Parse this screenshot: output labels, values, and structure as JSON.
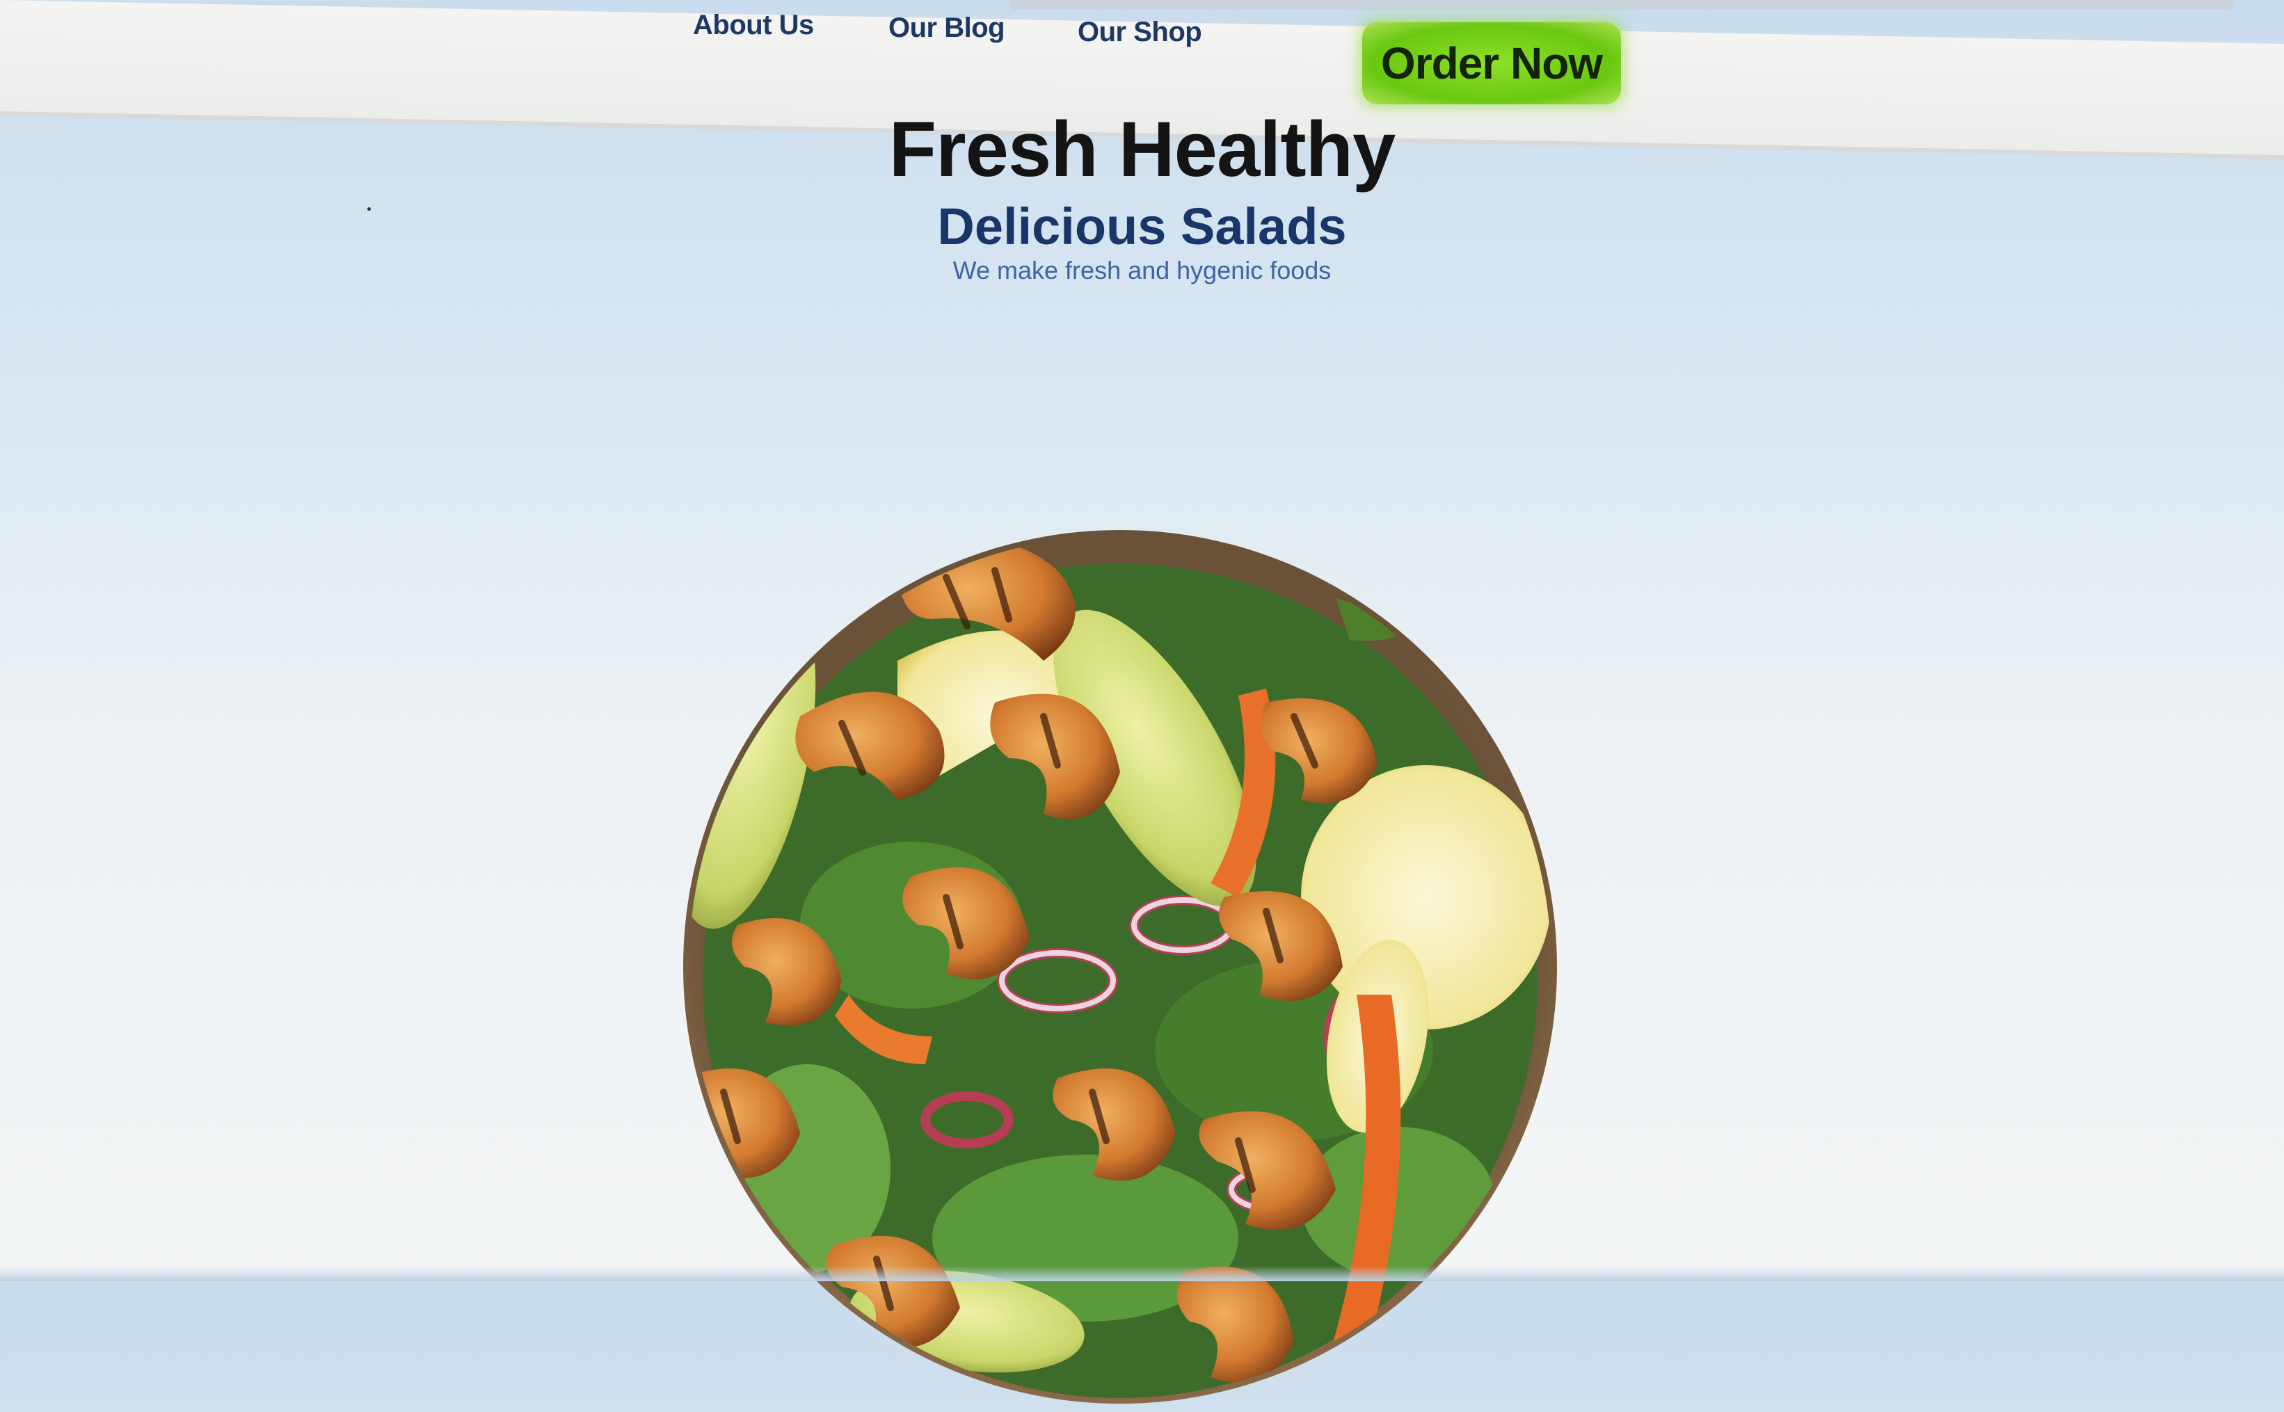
{
  "nav": {
    "links": [
      {
        "label": "About Us"
      },
      {
        "label": "Our Blog"
      },
      {
        "label": "Our Shop"
      }
    ],
    "cta_label": "Order Now"
  },
  "hero": {
    "title": "Fresh Healthy",
    "subtitle": "Delicious Salads",
    "tagline": "We make fresh and hygenic foods"
  },
  "image": {
    "icon": "shrimp-salad-bowl-image"
  },
  "colors": {
    "cta_background": "#6cc814",
    "subtitle_text": "#1a3569",
    "tagline_text": "#3f63a6",
    "page_background": "#dbe8f2"
  }
}
